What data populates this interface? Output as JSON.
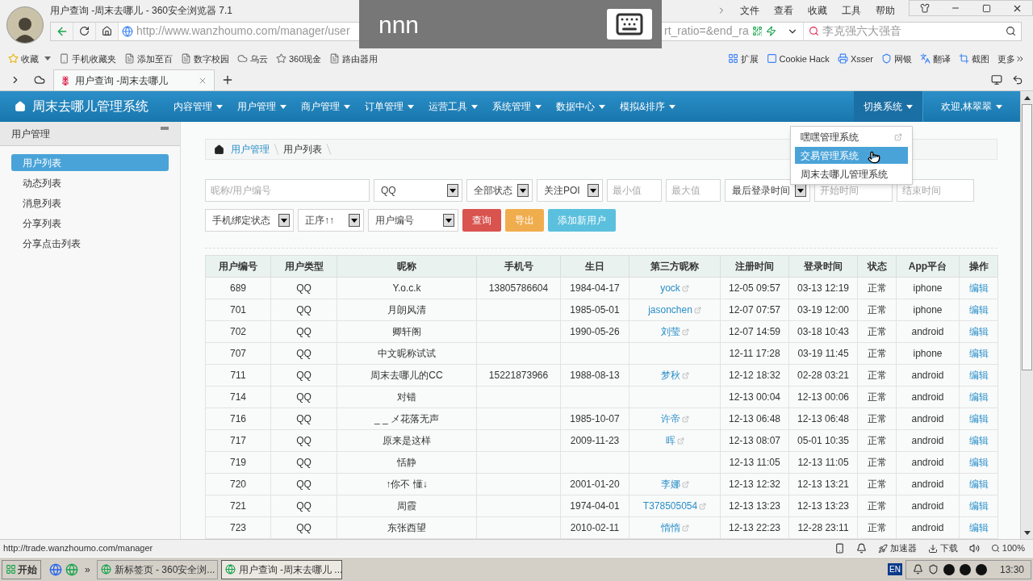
{
  "browser": {
    "title": "用户查询 -周末去哪儿 - 360安全浏览器 7.1",
    "menu": [
      "文件",
      "查看",
      "收藏",
      "工具",
      "帮助"
    ],
    "url_start": "http://www.wanzhoumo.com/manager/user",
    "url_end": "rt_ratio=&end_ra",
    "search_placeholder": "李克强六大强音",
    "bookmarks": [
      {
        "label": "收藏",
        "kind": "star"
      },
      {
        "label": "手机收藏夹",
        "kind": "phone"
      },
      {
        "label": "添加至百",
        "kind": "page"
      },
      {
        "label": "数字校园",
        "kind": "page"
      },
      {
        "label": "乌云",
        "kind": "cloud"
      },
      {
        "label": "360现金",
        "kind": "badge"
      },
      {
        "label": "路由器用",
        "kind": "page"
      }
    ],
    "extensions": [
      {
        "label": "扩展",
        "kind": "grid"
      },
      {
        "label": "Cookie Hack",
        "kind": "mask"
      },
      {
        "label": "Xsser",
        "kind": "printer"
      },
      {
        "label": "网银",
        "kind": "shield"
      },
      {
        "label": "翻译",
        "kind": "translate"
      },
      {
        "label": "截图",
        "kind": "crop"
      }
    ],
    "more": "更多",
    "tabs": [
      {
        "label": "用户查询 -周末去哪儿",
        "selected": true
      }
    ]
  },
  "overlay": {
    "text": "nnn"
  },
  "app": {
    "brand": "周末去哪儿管理系统",
    "nav": [
      "内容管理",
      "用户管理",
      "商户管理",
      "订单管理",
      "运营工具",
      "系统管理",
      "数据中心",
      "模拟&排序"
    ],
    "switch": "切换系统",
    "welcome": "欢迎,林翠翠",
    "switch_menu": [
      {
        "label": "嘿嘿管理系统",
        "selected": false,
        "external": true
      },
      {
        "label": "交易管理系统",
        "selected": true,
        "external": false
      },
      {
        "label": "周末去哪儿管理系统",
        "selected": false,
        "external": false
      }
    ]
  },
  "sidebar": {
    "header": "用户管理",
    "items": [
      {
        "label": "用户列表",
        "selected": true
      },
      {
        "label": "动态列表",
        "selected": false
      },
      {
        "label": "消息列表",
        "selected": false
      },
      {
        "label": "分享列表",
        "selected": false
      },
      {
        "label": "分享点击列表",
        "selected": false
      }
    ]
  },
  "breadcrumb": [
    {
      "label": "用户管理",
      "kind": "link"
    },
    {
      "label": "用户列表",
      "kind": "current"
    }
  ],
  "filters": [
    [
      {
        "kind": "input",
        "placeholder": "昵称/用户编号"
      },
      {
        "kind": "select",
        "value": "QQ"
      },
      {
        "kind": "select",
        "value": "全部状态"
      },
      {
        "kind": "select",
        "value": "关注POI"
      },
      {
        "kind": "input",
        "placeholder": "最小值"
      },
      {
        "kind": "input",
        "placeholder": "最大值"
      },
      {
        "kind": "select",
        "value": "最后登录时间"
      },
      {
        "kind": "input",
        "placeholder": "开始时间"
      },
      {
        "kind": "input",
        "placeholder": "结束时间"
      }
    ],
    [
      {
        "kind": "select",
        "value": "手机绑定状态"
      },
      {
        "kind": "select",
        "value": "正序↑↑"
      },
      {
        "kind": "select",
        "value": "用户编号"
      },
      {
        "kind": "button",
        "label": "查询",
        "color": "#d9534f"
      },
      {
        "kind": "button",
        "label": "导出",
        "color": "#f0ad4e"
      },
      {
        "kind": "button",
        "label": "添加新用户",
        "color": "#5bc0de"
      }
    ]
  ],
  "table": {
    "columns": [
      "用户编号",
      "用户类型",
      "昵称",
      "手机号",
      "生日",
      "第三方昵称",
      "注册时间",
      "登录时间",
      "状态",
      "App平台",
      "操作"
    ],
    "rows": [
      [
        "689",
        "QQ",
        "Y.o.c.k",
        "13805786604",
        "1984-04-17",
        "yock",
        "12-05 09:57",
        "03-13 12:19",
        "正常",
        "iphone",
        "编辑"
      ],
      [
        "701",
        "QQ",
        "月朗风清",
        "",
        "1985-05-01",
        "jasonchen",
        "12-07 07:57",
        "03-19 12:00",
        "正常",
        "iphone",
        "编辑"
      ],
      [
        "702",
        "QQ",
        "卿轩阁",
        "",
        "1990-05-26",
        "刘莹",
        "12-07 14:59",
        "03-18 10:43",
        "正常",
        "android",
        "编辑"
      ],
      [
        "707",
        "QQ",
        "中文昵称试试",
        "",
        "",
        "",
        "12-11 17:28",
        "03-19 11:45",
        "正常",
        "iphone",
        "编辑"
      ],
      [
        "711",
        "QQ",
        "周末去哪儿的CC",
        "15221873966",
        "1988-08-13",
        "梦秋",
        "12-12 18:32",
        "02-28 03:21",
        "正常",
        "android",
        "编辑"
      ],
      [
        "714",
        "QQ",
        "对错",
        "",
        "",
        "",
        "12-13 00:04",
        "12-13 00:06",
        "正常",
        "android",
        "编辑"
      ],
      [
        "716",
        "QQ",
        "_ _ メ花落无声",
        "",
        "1985-10-07",
        "许帝",
        "12-13 06:48",
        "12-13 06:48",
        "正常",
        "android",
        "编辑"
      ],
      [
        "717",
        "QQ",
        "原来是这样",
        "",
        "2009-11-23",
        "晖",
        "12-13 08:07",
        "05-01 10:35",
        "正常",
        "android",
        "编辑"
      ],
      [
        "719",
        "QQ",
        "恬静",
        "",
        "",
        "",
        "12-13 11:05",
        "12-13 11:05",
        "正常",
        "android",
        "编辑"
      ],
      [
        "720",
        "QQ",
        "↑你不 懂↓",
        "",
        "2001-01-20",
        "李娜",
        "12-13 12:32",
        "12-13 13:21",
        "正常",
        "android",
        "编辑"
      ],
      [
        "721",
        "QQ",
        "周霞",
        "",
        "1974-04-01",
        "T378505054",
        "12-13 13:23",
        "12-13 13:23",
        "正常",
        "android",
        "编辑"
      ],
      [
        "723",
        "QQ",
        "东张西望",
        "",
        "2010-02-11",
        "惰惰",
        "12-13 22:23",
        "12-28 23:11",
        "正常",
        "android",
        "编辑"
      ]
    ]
  },
  "status_bar": {
    "url": "http://trade.wanzhoumo.com/manager",
    "accelerator": "加速器",
    "download": "下载",
    "zoom": "100%"
  },
  "taskbar": {
    "start": "开始",
    "more": "»",
    "tasks": [
      {
        "label": "新标签页 - 360安全浏...",
        "selected": false
      },
      {
        "label": "用户查询 -周末去哪儿 ...",
        "selected": true
      }
    ],
    "lang": "EN",
    "time": "13:30"
  }
}
